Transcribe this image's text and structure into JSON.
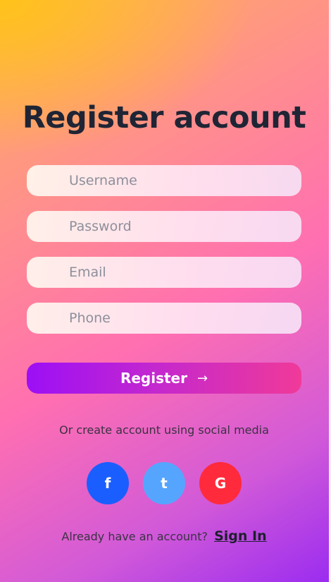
{
  "title": "Register account",
  "fields": {
    "username_placeholder": "Username",
    "password_placeholder": "Password",
    "email_placeholder": "Email",
    "phone_placeholder": "Phone"
  },
  "register_button": {
    "label": "Register",
    "arrow": "→"
  },
  "social": {
    "text": "Or create account using social media",
    "facebook": "f",
    "twitter": "t",
    "google": "G"
  },
  "footer": {
    "text": "Already have an account?",
    "signin": "Sign In"
  },
  "colors": {
    "facebook": "#1b5eff",
    "twitter": "#55a5ff",
    "google": "#ff2a3b",
    "title": "#1f2535"
  }
}
